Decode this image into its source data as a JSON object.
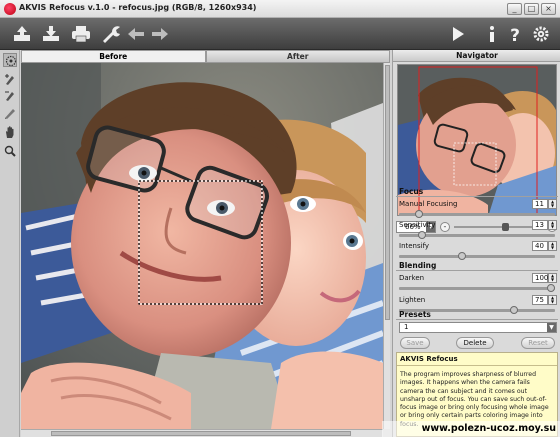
{
  "window": {
    "title": "AKVIS Refocus v.1.0 - refocus.jpg (RGB/8, 1260x934)",
    "buttons": [
      "_",
      "□",
      "×"
    ]
  },
  "toolbar": {
    "left_icons": [
      "open-icon",
      "save-icon",
      "print-icon",
      "preferences-icon",
      "undo-icon",
      "redo-icon"
    ],
    "right_icons": [
      "run-icon",
      "info-icon",
      "help-icon",
      "settings-icon"
    ]
  },
  "tools": [
    "refocus-area-icon",
    "focus-brush-icon",
    "eraser-brush-icon",
    "pencil-icon",
    "hand-icon",
    "zoom-icon"
  ],
  "tabs": {
    "before": "Before",
    "after": "After"
  },
  "navigator": {
    "title": "Navigator",
    "zoom": "66%",
    "zoom_out": "-",
    "zoom_in": "+",
    "zoom_slider_fraction": 0.6
  },
  "focus": {
    "title": "Focus",
    "manual_focusing": {
      "label": "Manual Focusing",
      "value": "11",
      "fraction": 0.11
    },
    "sensitivity": {
      "label": "Sensitivity",
      "value": "13",
      "fraction": 0.13
    },
    "intensify": {
      "label": "Intensify",
      "value": "40",
      "fraction": 0.4
    }
  },
  "blending": {
    "title": "Blending",
    "darken": {
      "label": "Darken",
      "value": "100",
      "fraction": 1.0
    },
    "lighten": {
      "label": "Lighten",
      "value": "75",
      "fraction": 0.75
    }
  },
  "presets": {
    "title": "Presets",
    "selected": "1",
    "save_label": "Save",
    "delete_label": "Delete",
    "reset_label": "Reset"
  },
  "help": {
    "title": "AKVIS Refocus",
    "text": "The program improves sharpness of blurred images. It happens when the camera fails camera the can subject and it comes out unsharp out of focus. You can save such out-of-focus image or bring only focusing whole image or bring only certain parts coloring image into focus."
  },
  "watermark": "www.polezn-ucoz.moy.su"
}
